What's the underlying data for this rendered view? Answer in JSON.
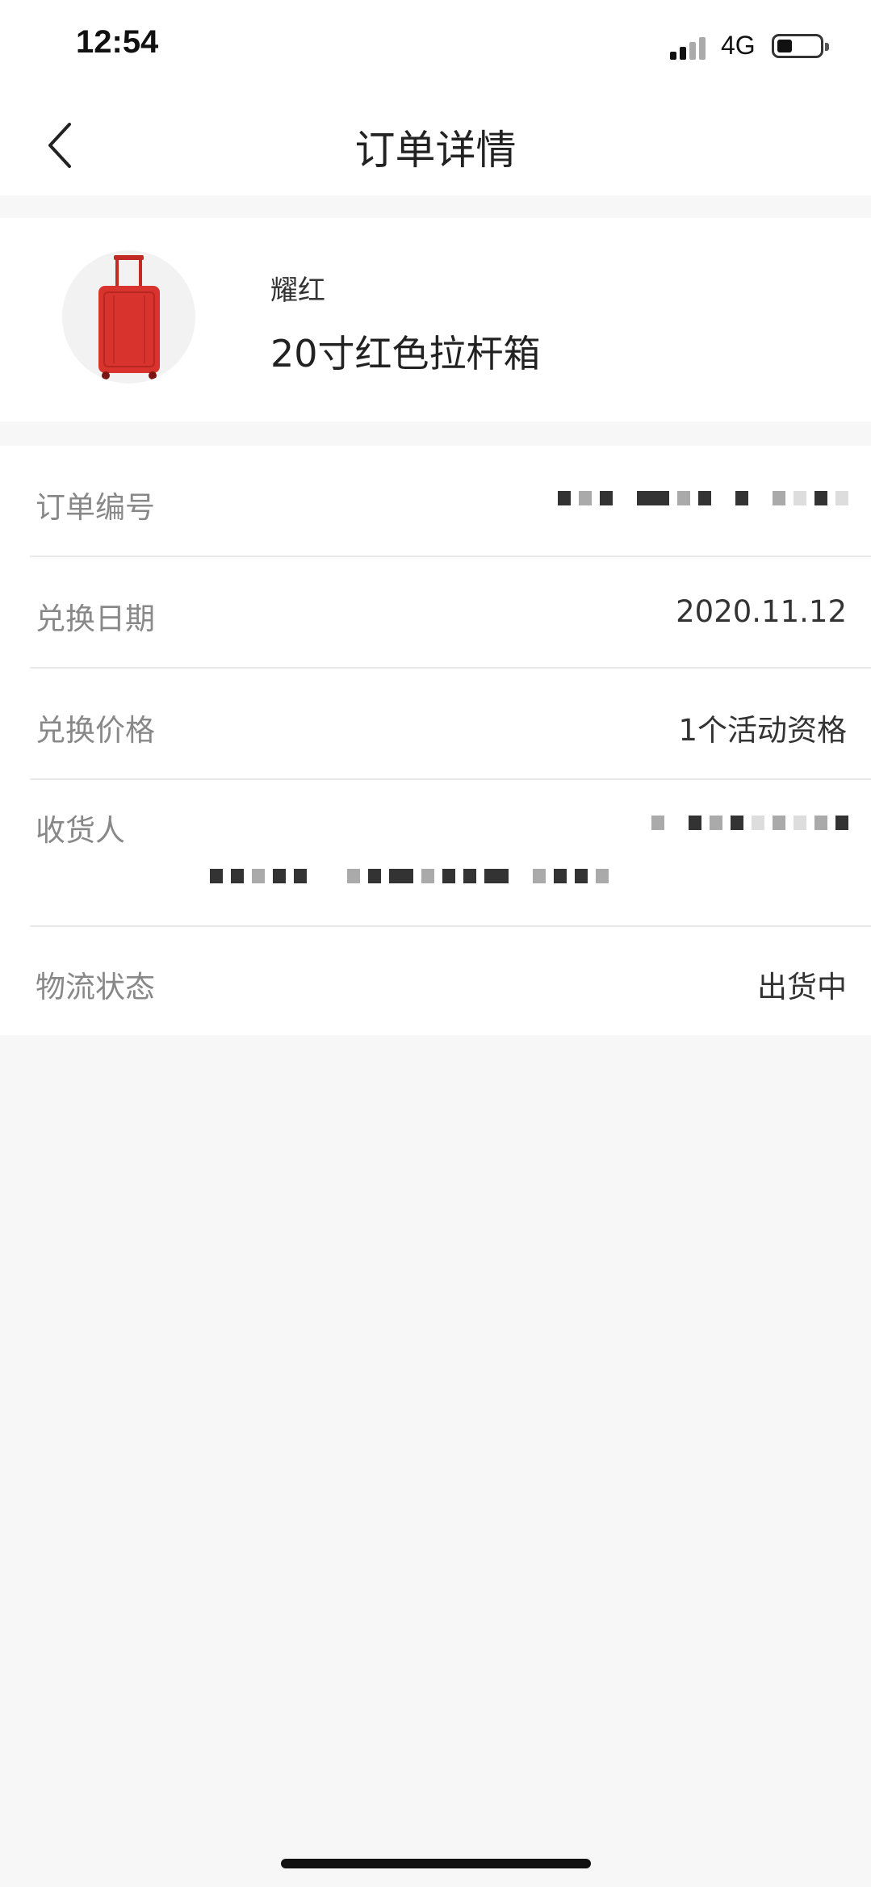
{
  "status_bar": {
    "time": "12:54",
    "network": "4G"
  },
  "nav": {
    "title": "订单详情"
  },
  "product": {
    "brand": "耀红",
    "name": "20寸红色拉杆箱"
  },
  "details": {
    "order_number_label": "订单编号",
    "exchange_date_label": "兑换日期",
    "exchange_date_value": "2020.11.12",
    "exchange_price_label": "兑换价格",
    "exchange_price_value": "1个活动资格",
    "recipient_label": "收货人",
    "logistics_label": "物流状态",
    "logistics_value": "出货中"
  },
  "colors": {
    "product_red": "#d8332c",
    "page_bg": "#f7f7f7",
    "label_gray": "#888888"
  },
  "icons": {
    "back": "chevron-left-icon"
  }
}
